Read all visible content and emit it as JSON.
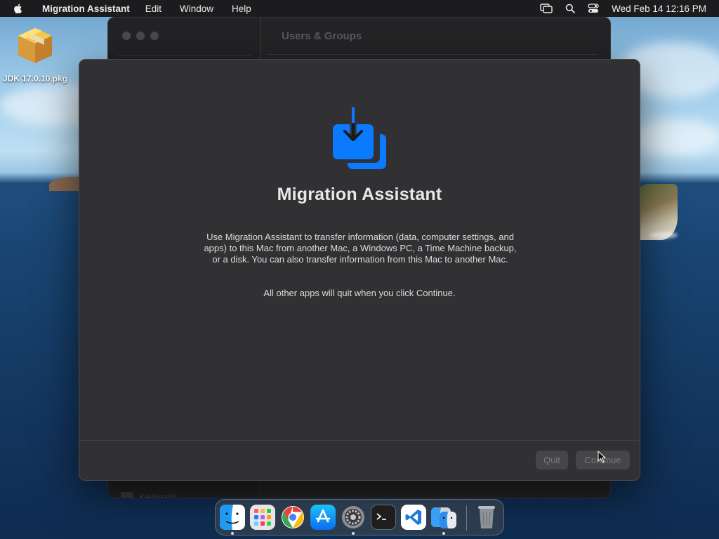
{
  "menubar": {
    "app_name": "Migration Assistant",
    "items": [
      "Edit",
      "Window",
      "Help"
    ],
    "clock": "Wed Feb 14  12:16 PM"
  },
  "desktop": {
    "icon_label": "JDK 17.0.10.pkg"
  },
  "background_window": {
    "title": "Users & Groups",
    "sidebar_bottom_item": "Keyboard"
  },
  "migration_window": {
    "title": "Migration Assistant",
    "description": "Use Migration Assistant to transfer information (data, computer settings, and apps) to this Mac from another Mac, a Windows PC, a Time Machine backup, or a disk. You can also transfer information from this Mac to another Mac.",
    "note": "All other apps will quit when you click Continue.",
    "quit_label": "Quit",
    "continue_label": "Continue"
  },
  "dock": {
    "apps": [
      "Finder",
      "Launchpad",
      "Google Chrome",
      "App Store",
      "System Settings",
      "Terminal",
      "Visual Studio Code",
      "Migration Assistant",
      "Trash"
    ]
  },
  "colors": {
    "accent_blue": "#0a7aff",
    "window_bg": "#313133",
    "menubar_bg": "#1c1c1e"
  }
}
